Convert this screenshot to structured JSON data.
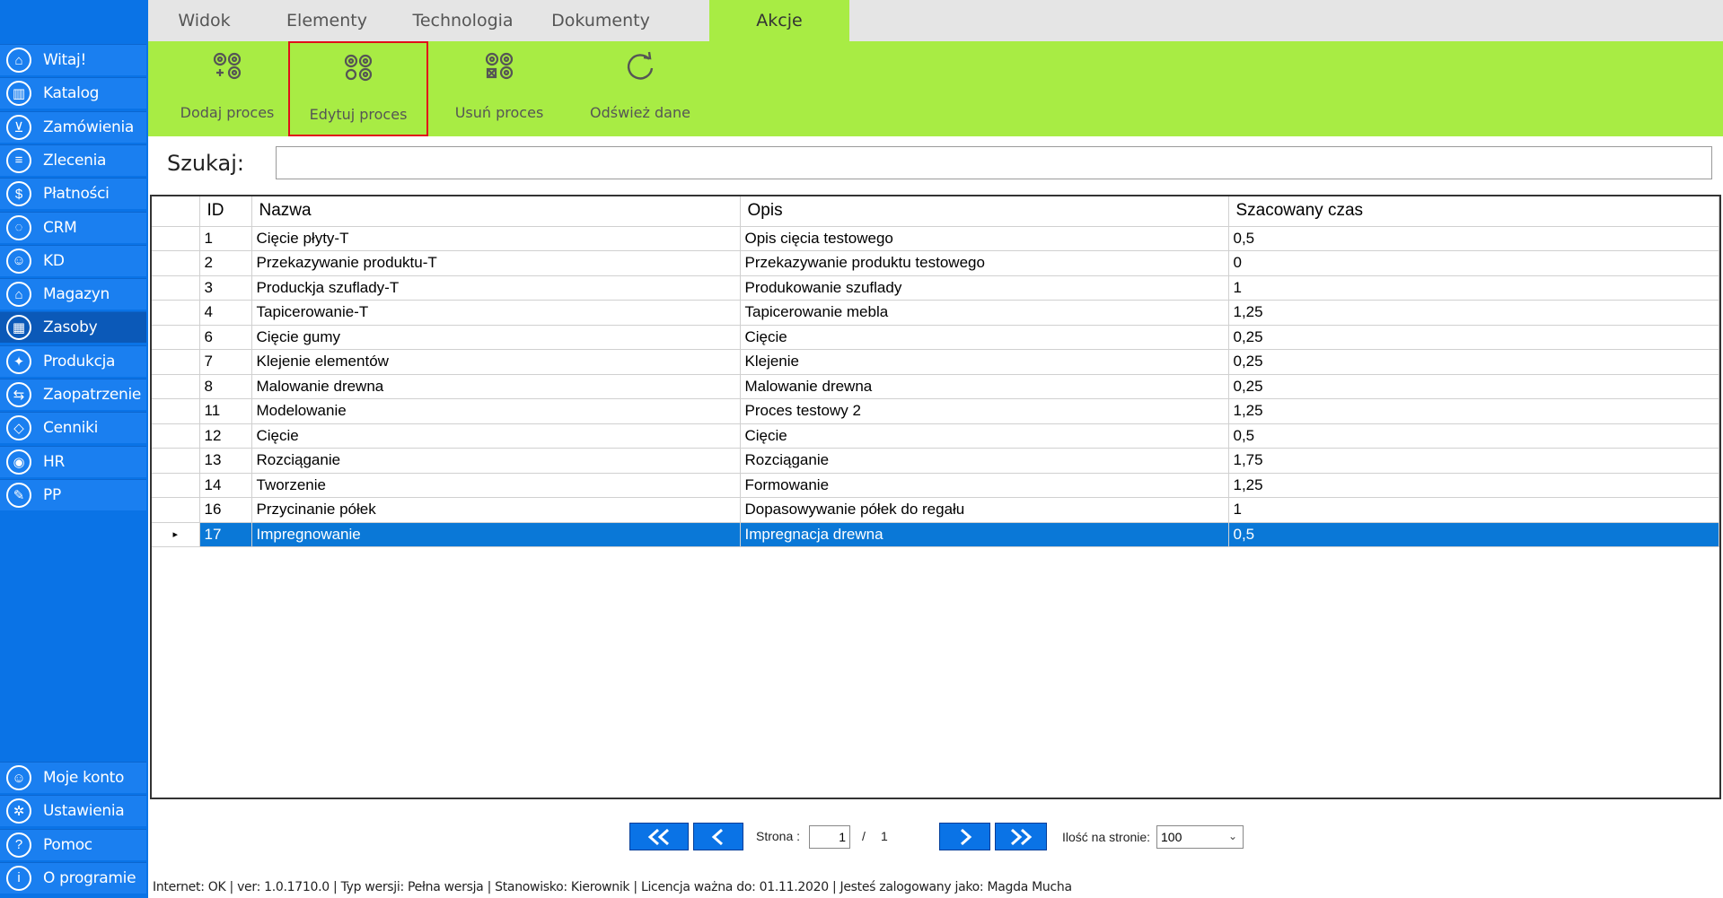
{
  "sidebar": {
    "items": [
      {
        "label": "Witaj!",
        "icon": "home-icon"
      },
      {
        "label": "Katalog",
        "icon": "book-icon"
      },
      {
        "label": "Zamówienia",
        "icon": "cart-icon"
      },
      {
        "label": "Zlecenia",
        "icon": "list-icon"
      },
      {
        "label": "Płatności",
        "icon": "dollar-icon"
      },
      {
        "label": "CRM",
        "icon": "crm-icon"
      },
      {
        "label": "KD",
        "icon": "user-icon"
      },
      {
        "label": "Magazyn",
        "icon": "warehouse-icon"
      },
      {
        "label": "Zasoby",
        "icon": "resources-icon"
      },
      {
        "label": "Produkcja",
        "icon": "production-icon"
      },
      {
        "label": "Zaopatrzenie",
        "icon": "truck-icon"
      },
      {
        "label": "Cenniki",
        "icon": "tag-icon"
      },
      {
        "label": "HR",
        "icon": "hr-icon"
      },
      {
        "label": "PP",
        "icon": "pp-icon"
      }
    ],
    "bottom_items": [
      {
        "label": "Moje konto",
        "icon": "account-icon"
      },
      {
        "label": "Ustawienia",
        "icon": "settings-icon"
      },
      {
        "label": "Pomoc",
        "icon": "help-icon"
      },
      {
        "label": "O programie",
        "icon": "info-icon"
      }
    ],
    "active": "Zasoby"
  },
  "tabs": [
    "Widok",
    "Elementy",
    "Technologia",
    "Dokumenty",
    "Akcje"
  ],
  "active_tab": "Akcje",
  "ribbon": {
    "add": "Dodaj proces",
    "edit": "Edytuj proces",
    "delete": "Usuń proces",
    "refresh": "Odśwież dane"
  },
  "search": {
    "label": "Szukaj:",
    "value": ""
  },
  "grid": {
    "columns": [
      "ID",
      "Nazwa",
      "Opis",
      "Szacowany czas"
    ],
    "rows": [
      [
        "1",
        "Cięcie płyty-T",
        "Opis cięcia testowego",
        "0,5"
      ],
      [
        "2",
        "Przekazywanie produktu-T",
        "Przekazywanie produktu testowego",
        "0"
      ],
      [
        "3",
        "Produckja szuflady-T",
        "Produkowanie szuflady",
        "1"
      ],
      [
        "4",
        "Tapicerowanie-T",
        "Tapicerowanie mebla",
        "1,25"
      ],
      [
        "6",
        "Cięcie gumy",
        "Cięcie",
        "0,25"
      ],
      [
        "7",
        "Klejenie elementów",
        "Klejenie",
        "0,25"
      ],
      [
        "8",
        "Malowanie drewna",
        "Malowanie drewna",
        "0,25"
      ],
      [
        "11",
        "Modelowanie",
        "Proces testowy 2",
        "1,25"
      ],
      [
        "12",
        "Cięcie",
        "Cięcie",
        "0,5"
      ],
      [
        "13",
        "Rozciąganie",
        "Rozciąganie",
        "1,75"
      ],
      [
        "14",
        "Tworzenie",
        "Formowanie",
        "1,25"
      ],
      [
        "16",
        "Przycinanie półek",
        "Dopasowywanie półek do regału",
        "1"
      ],
      [
        "17",
        "Impregnowanie",
        "Impregnacja drewna",
        "0,5"
      ]
    ],
    "selected_row_index": 12,
    "row_indicator": "▸"
  },
  "pager": {
    "page_label": "Strona :",
    "page": "1",
    "separator": "/",
    "total": "1",
    "per_page_label": "Ilość na stronie:",
    "per_page": "100"
  },
  "status": {
    "text": "Internet: OK  |   ver: 1.0.1710.0   |   Typ wersji: Pełna wersja   |   Stanowisko: Kierownik   |   Licencja ważna do: 01.11.2020   |   Jesteś zalogowany jako: Magda Mucha"
  },
  "colors": {
    "sidebar": "#0a73e6",
    "ribbon": "#a8ec44",
    "selection": "#0a78d7",
    "highlight_border": "#e0101a"
  }
}
